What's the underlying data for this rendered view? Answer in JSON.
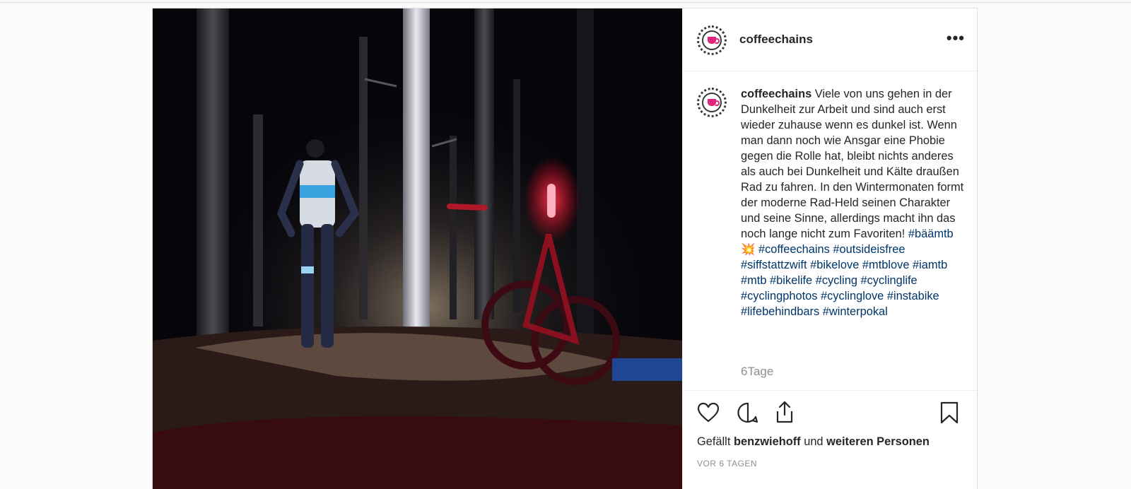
{
  "post": {
    "username": "coffeechains",
    "more_label": "•••",
    "caption": {
      "username": "coffeechains",
      "text": "Viele von uns gehen in der Dunkelheit zur Arbeit und sind auch erst wieder zuhause wenn es dunkel ist. Wenn man dann noch wie Ansgar eine Phobie gegen die Rolle hat, bleibt nichts anderes als auch bei Dunkelheit und Kälte draußen Rad zu fahren. In den Wintermonaten formt der moderne Rad-Held seinen Charakter und seine Sinne, allerdings macht ihn das noch lange nicht zum Favoriten!",
      "emoji": "💥",
      "hashtags": [
        "#bäämtb",
        "#coffeechains",
        "#outsideisfree",
        "#siffstattzwift",
        "#bikelove",
        "#mtblove",
        "#iamtb",
        "#mtb",
        "#bikelife",
        "#cycling",
        "#cyclinglife",
        "#cyclingphotos",
        "#cyclinglove",
        "#instabike",
        "#lifebehindbars",
        "#winterpokal"
      ]
    },
    "comment_age": "6Tage",
    "likes": {
      "prefix": "Gefällt",
      "user": "benzwiehoff",
      "conjunction": "und",
      "others": "weiteren Personen"
    },
    "timestamp": "VOR 6 TAGEN"
  },
  "icons": {
    "like": "heart-icon",
    "comment": "comment-icon",
    "share": "share-icon",
    "save": "bookmark-icon",
    "more": "more-options-icon"
  },
  "colors": {
    "hashtag": "#003569",
    "text": "#262626",
    "muted": "#8e8e8e",
    "brand_cup": "#e2247a"
  }
}
